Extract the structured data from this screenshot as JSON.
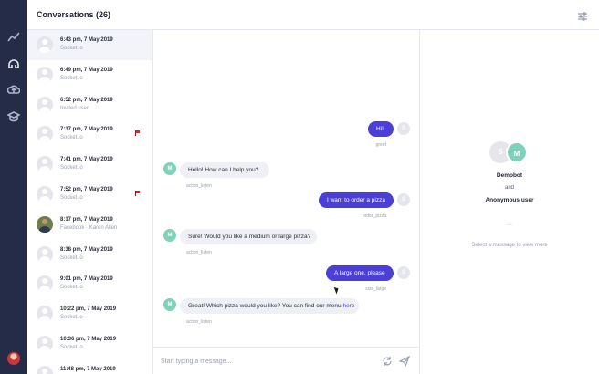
{
  "header": {
    "title": "Conversations (26)"
  },
  "conversations": [
    {
      "time": "6:43 pm, 7 May 2019",
      "source": "Socket.io",
      "user": "",
      "flag": false,
      "photo": false
    },
    {
      "time": "6:49 pm, 7 May 2019",
      "source": "Socket.io",
      "user": "",
      "flag": false,
      "photo": false
    },
    {
      "time": "6:52 pm, 7 May 2019",
      "source": "Invited user",
      "user": "",
      "flag": false,
      "photo": false
    },
    {
      "time": "7:37 pm, 7 May 2019",
      "source": "Socket.io",
      "user": "",
      "flag": true,
      "photo": false
    },
    {
      "time": "7:41 pm, 7 May 2019",
      "source": "Socket.io",
      "user": "",
      "flag": false,
      "photo": false
    },
    {
      "time": "7:52 pm, 7 May 2019",
      "source": "Socket.io",
      "user": "",
      "flag": true,
      "photo": false
    },
    {
      "time": "8:17 pm, 7 May 2019",
      "source": "Facebook",
      "user": "Karen Allen",
      "flag": false,
      "photo": true
    },
    {
      "time": "8:38 pm, 7 May 2019",
      "source": "Socket.io",
      "user": "",
      "flag": false,
      "photo": false
    },
    {
      "time": "9:01 pm, 7 May 2019",
      "source": "Socket.io",
      "user": "",
      "flag": false,
      "photo": false
    },
    {
      "time": "10:22 pm, 7 May 2019",
      "source": "Socket.io",
      "user": "",
      "flag": false,
      "photo": false
    },
    {
      "time": "10:36 pm, 7 May 2019",
      "source": "Socket.io",
      "user": "",
      "flag": false,
      "photo": false
    },
    {
      "time": "11:48 pm, 7 May 2019",
      "source": "Socket.io",
      "user": "",
      "flag": false,
      "photo": false
    }
  ],
  "messages": [
    {
      "from": "user",
      "text": "Hi!",
      "intent": "greet",
      "avatar": "S"
    },
    {
      "from": "bot",
      "text": "Hello! How can I help you?",
      "intent": "action_listen",
      "avatar": "M"
    },
    {
      "from": "user",
      "text": "I want to order a pizza",
      "intent": "order_pizza",
      "avatar": "S"
    },
    {
      "from": "bot",
      "text": "Sure! Would you like a medium or large pizza?",
      "intent": "action_listen",
      "avatar": "M"
    },
    {
      "from": "user",
      "text": "A large one, please",
      "intent": "size_large",
      "avatar": "S"
    },
    {
      "from": "bot",
      "text": "Great! Which pizza would you like? You can find our menu ",
      "link": "here",
      "intent": "action_listen",
      "avatar": "M"
    }
  ],
  "composer": {
    "placeholder": "Start typing a message..."
  },
  "info": {
    "avatar_user": "S",
    "avatar_bot": "M",
    "bot_name": "Demobot",
    "and": "and",
    "user_name": "Anonymous user",
    "dash": "—",
    "hint": "Select a message to view more"
  },
  "rail": {
    "icons": [
      "analytics-icon",
      "conversations-icon",
      "deploy-icon",
      "training-icon"
    ]
  },
  "colors": {
    "rail": "#242c48",
    "accent": "#4a3fd8",
    "bot": "#7fd1b9"
  }
}
